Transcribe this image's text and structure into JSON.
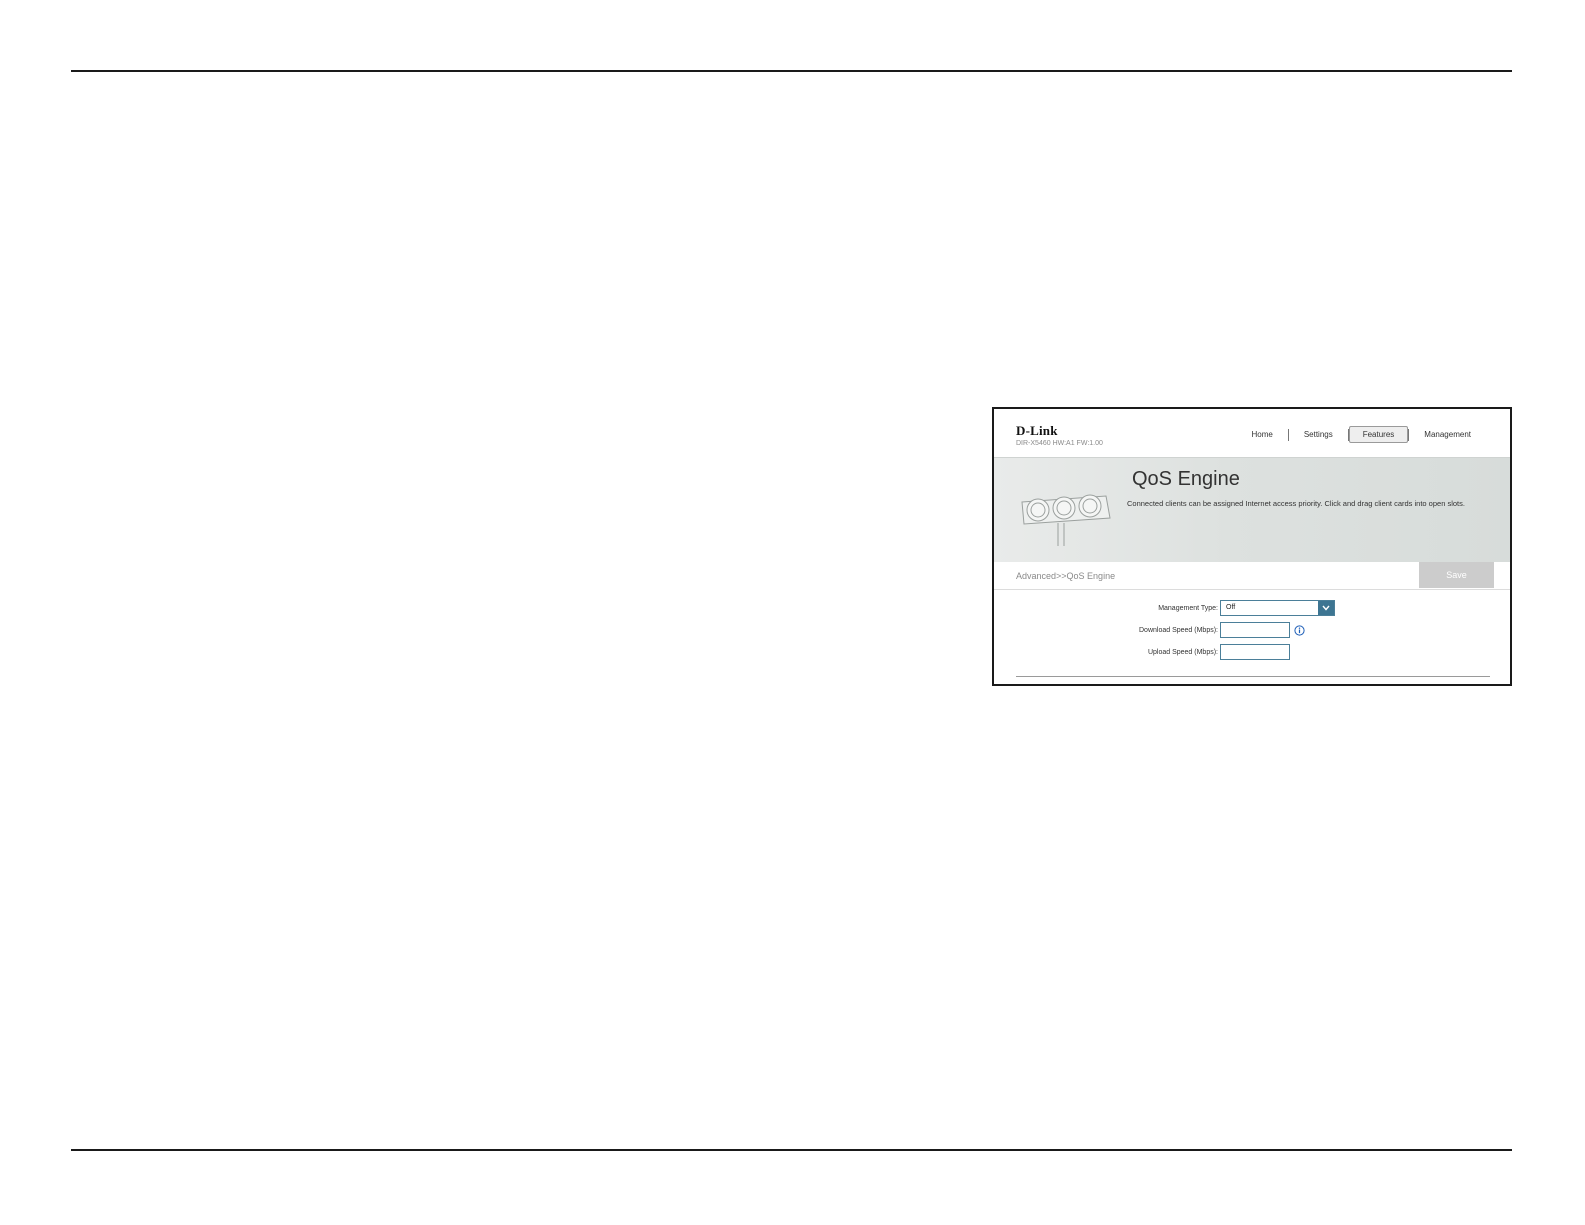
{
  "router_ui": {
    "brand": {
      "logo": "D-Link",
      "model": "DIR-X5460 HW:A1 FW:1.00"
    },
    "nav": [
      {
        "label": "Home",
        "active": false
      },
      {
        "label": "Settings",
        "active": false
      },
      {
        "label": "Features",
        "active": true
      },
      {
        "label": "Management",
        "active": false
      }
    ],
    "banner": {
      "title": "QoS Engine",
      "description": "Connected clients can be assigned Internet access priority. Click and drag client cards into open slots.",
      "illustration_icon": "traffic-light-icon"
    },
    "breadcrumb": "Advanced>>QoS Engine",
    "save_label": "Save",
    "form": {
      "management_type": {
        "label": "Management Type:",
        "value": "Off"
      },
      "download_speed": {
        "label": "Download Speed (Mbps):",
        "value": ""
      },
      "upload_speed": {
        "label": "Upload Speed (Mbps):",
        "value": ""
      }
    }
  },
  "colors": {
    "accent": "#3d7592",
    "save_disabled": "#cccccc",
    "info_icon": "#1f5fb8"
  }
}
